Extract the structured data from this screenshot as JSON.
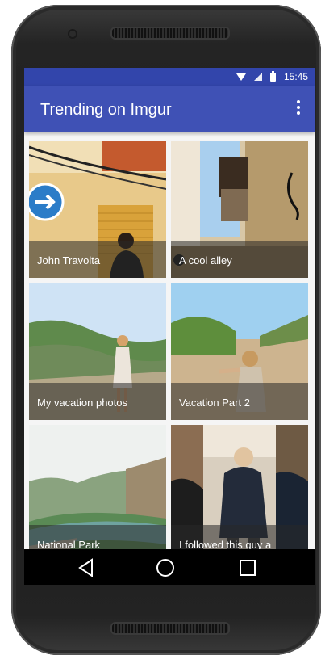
{
  "status_bar": {
    "time": "15:45",
    "icons": [
      "wifi-icon",
      "signal-icon",
      "battery-icon"
    ]
  },
  "app_bar": {
    "title": "Trending on Imgur",
    "menu_icon": "more-vert-icon"
  },
  "gallery": [
    {
      "caption": "John Travolta"
    },
    {
      "caption": "A cool alley"
    },
    {
      "caption": "My vacation photos"
    },
    {
      "caption": "Vacation Part 2"
    },
    {
      "caption": "National Park"
    },
    {
      "caption": "I followed this guy a"
    }
  ],
  "nav": {
    "back": "back-icon",
    "home": "home-icon",
    "recents": "recents-icon"
  },
  "colors": {
    "primary": "#3f51b5",
    "status_bar": "#3245ab"
  }
}
